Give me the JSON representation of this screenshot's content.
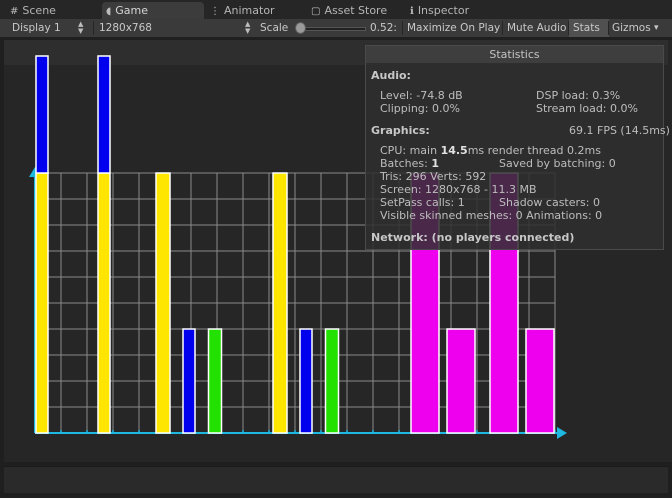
{
  "tabs": [
    {
      "icon": "scene-icon",
      "glyph": "#",
      "label": "Scene"
    },
    {
      "icon": "game-icon",
      "glyph": "◖",
      "label": "Game"
    },
    {
      "icon": "animator-icon",
      "glyph": "⋮",
      "label": "Animator"
    },
    {
      "icon": "asset-store-icon",
      "glyph": "▢",
      "label": "Asset Store"
    },
    {
      "icon": "info-icon",
      "glyph": "ℹ",
      "label": "Inspector"
    }
  ],
  "toolbar": {
    "display": "Display 1",
    "resolution": "1280x768",
    "scale_label": "Scale",
    "scale_value": "0.52:",
    "scale_fraction": 0.05,
    "maximize": "Maximize On Play",
    "mute": "Mute Audio",
    "stats": "Stats",
    "gizmos": "Gizmos"
  },
  "stats": {
    "title": "Statistics",
    "audio_header": "Audio:",
    "level": "Level: -74.8 dB",
    "dsp": "DSP load: 0.3%",
    "clipping": "Clipping: 0.0%",
    "stream": "Stream load: 0.0%",
    "graphics_header": "Graphics:",
    "fps": "69.1 FPS (14.5ms)",
    "cpu_prefix": "CPU: main ",
    "cpu_main": "14.5",
    "cpu_suffix": "ms  render thread 0.2ms",
    "batches_prefix": "Batches: ",
    "batches": "1",
    "saved": "Saved by batching: 0",
    "tris": "Tris: 296  Verts: 592",
    "screen": "Screen: 1280x768 - 11.3 MB",
    "setpass": "SetPass calls: 1",
    "shadow": "Shadow casters: 0",
    "skinned": "Visible skinned meshes: 0  Animations: 0",
    "network": "Network: (no players connected)"
  },
  "scene": {
    "colors": {
      "yellow": "#ffe600",
      "blue": "#0000ee",
      "green": "#22e000",
      "magenta": "#ee00ee",
      "axis": "#1fb8e0",
      "grid": "#8a8a8a"
    },
    "bars": [
      {
        "color": "yellow",
        "value": 10,
        "stack": 4.5,
        "stack_color": "blue"
      },
      {
        "color": "yellow",
        "value": 10,
        "stack": 4.5,
        "stack_color": "blue"
      },
      {
        "color": "yellow",
        "value": 10
      },
      {
        "color": "blue",
        "value": 4
      },
      {
        "color": "green",
        "value": 4
      },
      {
        "color": "yellow",
        "value": 10
      },
      {
        "color": "blue",
        "value": 4
      },
      {
        "color": "green",
        "value": 4
      },
      {
        "color": "magenta",
        "value": 10
      },
      {
        "color": "magenta",
        "value": 4
      },
      {
        "color": "magenta",
        "value": 10
      },
      {
        "color": "magenta",
        "value": 4
      }
    ]
  }
}
